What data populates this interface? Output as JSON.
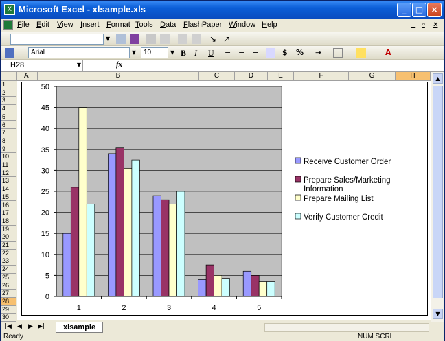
{
  "window": {
    "title": "Microsoft Excel - xlsample.xls"
  },
  "menu": [
    "File",
    "Edit",
    "View",
    "Insert",
    "Format",
    "Tools",
    "Data",
    "FlashPaper",
    "Window",
    "Help"
  ],
  "toolbar": {
    "font_name": "Arial",
    "font_size": "10"
  },
  "formula_bar": {
    "cell_ref": "H28",
    "fx": "fx"
  },
  "columns": [
    "A",
    "B",
    "C",
    "D",
    "E",
    "F",
    "G",
    "H"
  ],
  "selected_column": "H",
  "rows": [
    "1",
    "2",
    "3",
    "4",
    "5",
    "6",
    "7",
    "8",
    "9",
    "10",
    "11",
    "12",
    "13",
    "14",
    "15",
    "16",
    "17",
    "18",
    "19",
    "20",
    "21",
    "22",
    "23",
    "24",
    "25",
    "26",
    "27",
    "28",
    "29",
    "30"
  ],
  "selected_row": "28",
  "sheet_tab": "xlsample",
  "status": {
    "left": "Ready",
    "right": "NUM  SCRL"
  },
  "chart_data": {
    "type": "bar",
    "categories": [
      "1",
      "2",
      "3",
      "4",
      "5"
    ],
    "ylim": [
      0,
      50
    ],
    "yticks": [
      "0",
      "5",
      "10",
      "15",
      "20",
      "25",
      "30",
      "35",
      "40",
      "45",
      "50"
    ],
    "grid": true,
    "legend_position": "right",
    "series": [
      {
        "name": "Receive Customer Order",
        "color": "#9999ff",
        "values": [
          15,
          34,
          24,
          4,
          6
        ]
      },
      {
        "name": "Prepare Sales/Marketing Information",
        "color": "#993366",
        "values": [
          26,
          35.5,
          23,
          7.5,
          5
        ]
      },
      {
        "name": "Prepare Mailing List",
        "color": "#ffffcc",
        "values": [
          45,
          30.5,
          22,
          5,
          3.5
        ]
      },
      {
        "name": "Verify Customer Credit",
        "color": "#ccffff",
        "values": [
          22,
          32.5,
          25,
          4.3,
          3.5
        ]
      }
    ],
    "plot_background": "#c0c0c0"
  }
}
